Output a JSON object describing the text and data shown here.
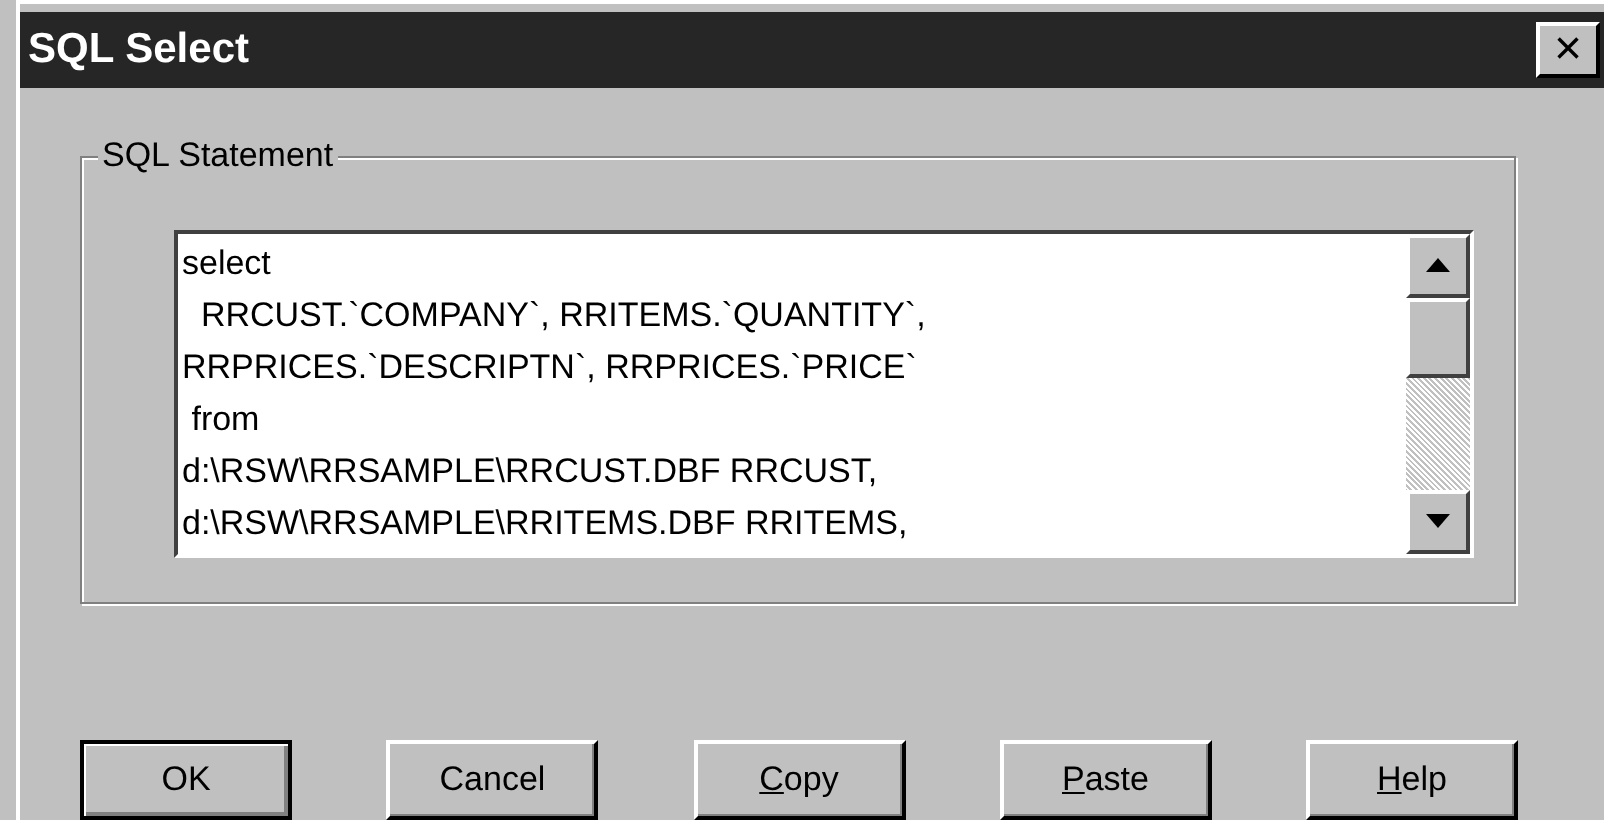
{
  "window": {
    "title": "SQL Select",
    "close": "×"
  },
  "group": {
    "label": "SQL Statement",
    "lines": [
      "select",
      "  RRCUST.`COMPANY`, RRITEMS.`QUANTITY`,",
      "RRPRICES.`DESCRIPTN`, RRPRICES.`PRICE`",
      " from",
      "d:\\RSW\\RRSAMPLE\\RRCUST.DBF RRCUST,",
      "d:\\RSW\\RRSAMPLE\\RRITEMS.DBF RRITEMS,"
    ]
  },
  "buttons": [
    {
      "rest": "OK",
      "default": true
    },
    {
      "rest": "Cancel",
      "default": false
    },
    {
      "accel": "C",
      "rest": "opy",
      "default": false
    },
    {
      "accel": "P",
      "rest": "aste",
      "default": false
    },
    {
      "accel": "H",
      "rest": "elp",
      "default": false
    }
  ]
}
